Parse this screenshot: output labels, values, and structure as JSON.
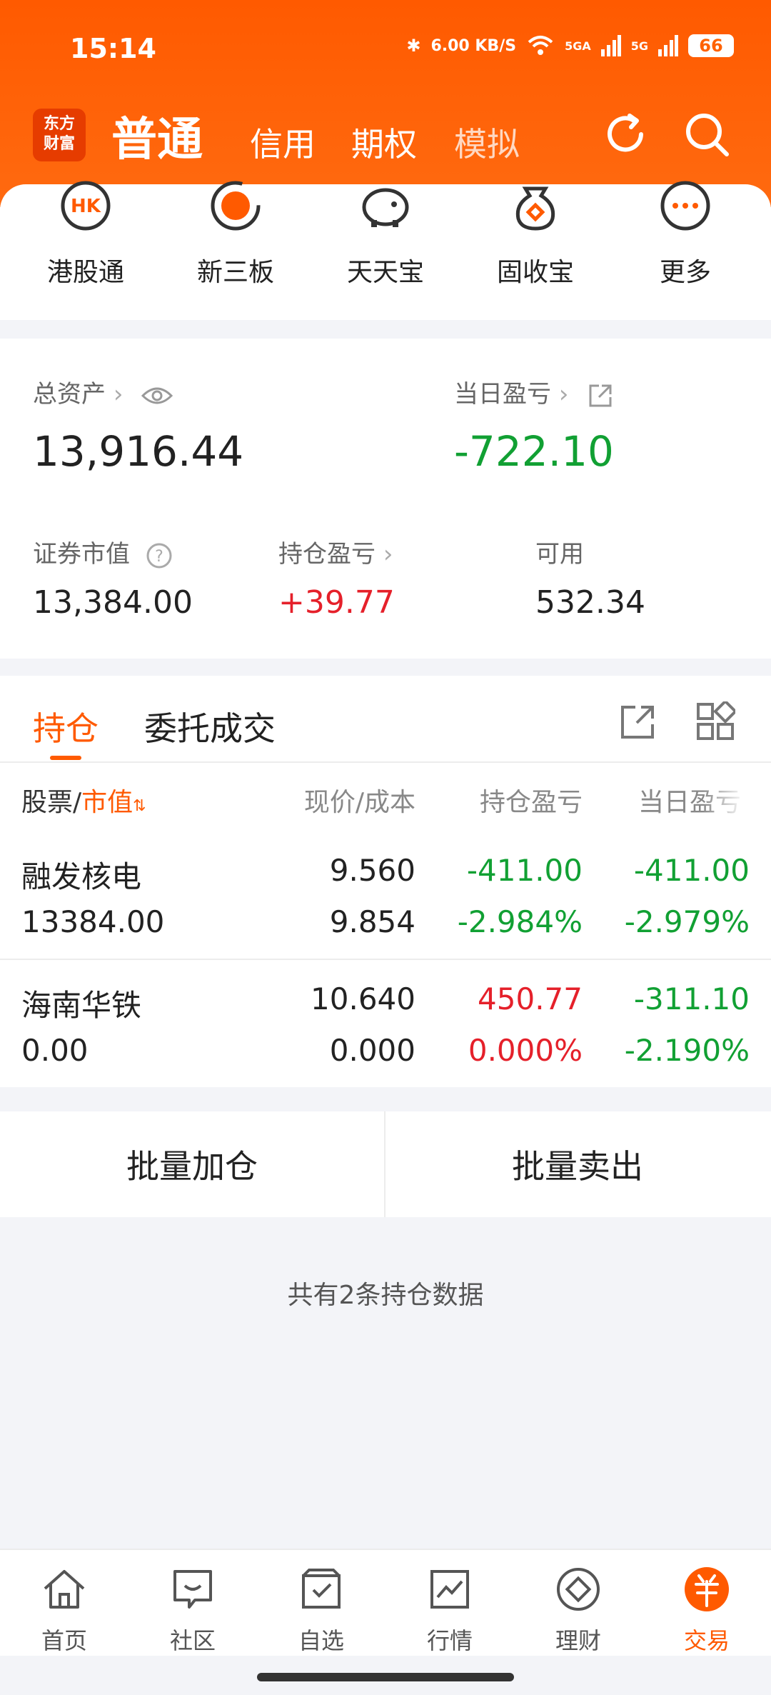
{
  "status": {
    "time": "15:14",
    "speed": "6.00 KB/S",
    "signal1": "5GA",
    "signal2": "5G",
    "battery": "66"
  },
  "header": {
    "logo_line1": "东方",
    "logo_line2": "财富",
    "active_tab": "普通",
    "tabs": [
      "信用",
      "期权",
      "模拟"
    ]
  },
  "shortcuts": [
    {
      "label": "港股通",
      "icon": "hk-icon"
    },
    {
      "label": "新三板",
      "icon": "new-board-icon"
    },
    {
      "label": "天天宝",
      "icon": "piggy-bank-icon"
    },
    {
      "label": "固收宝",
      "icon": "bag-icon"
    },
    {
      "label": "更多",
      "icon": "more-icon"
    }
  ],
  "assets": {
    "total_label": "总资产",
    "total_value": "13,916.44",
    "daily_label": "当日盈亏",
    "daily_value": "-722.10",
    "securities_label": "证券市值",
    "securities_value": "13,384.00",
    "holding_label": "持仓盈亏",
    "holding_value": "+39.77",
    "available_label": "可用",
    "available_value": "532.34"
  },
  "positions": {
    "tabs": [
      "持仓",
      "委托成交"
    ],
    "headers": {
      "stock": "股票",
      "slash": "/",
      "mv": "市值",
      "price": "现价/成本",
      "pnl": "持仓盈亏",
      "daily": "当日盈亏"
    },
    "rows": [
      {
        "name": "融发核电",
        "mv": "13384.00",
        "price": "9.560",
        "cost": "9.854",
        "pnl": "-411.00",
        "pnl_pct": "-2.984%",
        "daily": "-411.00",
        "daily_pct": "-2.979%"
      },
      {
        "name": "海南华铁",
        "mv": "0.00",
        "price": "10.640",
        "cost": "0.000",
        "pnl": "450.77",
        "pnl_pct": "0.000%",
        "daily": "-311.10",
        "daily_pct": "-2.190%"
      }
    ]
  },
  "actions": {
    "add": "批量加仓",
    "sell": "批量卖出"
  },
  "footnote": "共有2条持仓数据",
  "nav": [
    {
      "label": "首页",
      "icon": "home-icon"
    },
    {
      "label": "社区",
      "icon": "community-icon"
    },
    {
      "label": "自选",
      "icon": "watchlist-icon"
    },
    {
      "label": "行情",
      "icon": "market-icon"
    },
    {
      "label": "理财",
      "icon": "wealth-icon"
    },
    {
      "label": "交易",
      "icon": "trade-icon"
    }
  ],
  "colors": {
    "brand": "#ff5a00",
    "up": "#e5202a",
    "down": "#11a033"
  }
}
